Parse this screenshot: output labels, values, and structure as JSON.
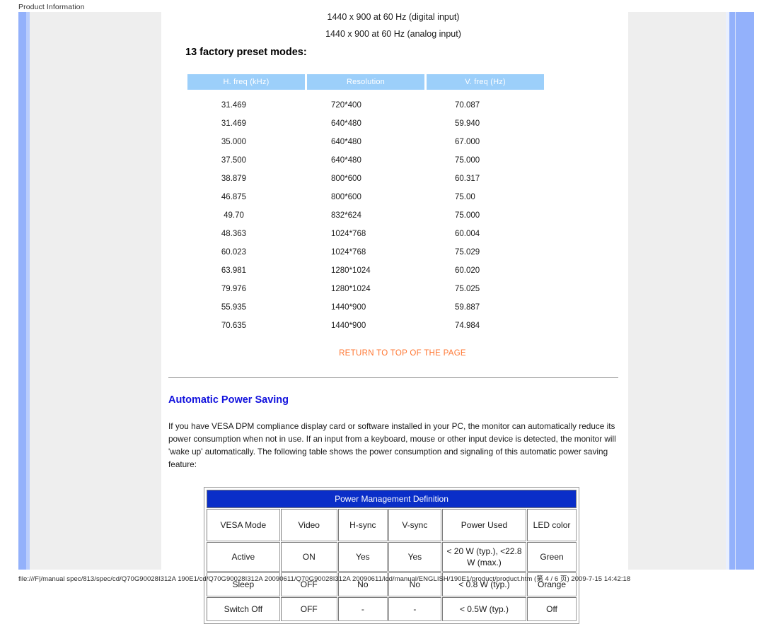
{
  "window": {
    "header_label": "Product Information",
    "footer_status": "file:///F|/manual spec/813/spec/cd/Q70G90028I312A 190E1/cd/Q70G90028I312A 20090611/Q70G90028I312A 20090611/lcd/manual/ENGLISH/190E1/product/product.htm (第 4 / 6 页) 2009-7-15 14:42:18"
  },
  "colors": {
    "rail_blue": "#93b1fb",
    "panel_grey": "#eeeeee",
    "preset_header_blue": "#9ccffa",
    "pm_header_blue": "#0a2ec8",
    "link_orange": "#FF7733",
    "heading_blue": "#1111dd"
  },
  "resolution_lines": [
    "1440 x 900 at 60 Hz (digital input)",
    "1440 x 900 at 60 Hz (analog input)"
  ],
  "preset_section": {
    "title": "13 factory preset modes:",
    "columns": [
      "H. freq (kHz)",
      "Resolution",
      "V. freq (Hz)"
    ],
    "rows": [
      [
        "31.469",
        "720*400",
        "70.087"
      ],
      [
        "31.469",
        "640*480",
        "59.940"
      ],
      [
        "35.000",
        "640*480",
        "67.000"
      ],
      [
        "37.500",
        "640*480",
        "75.000"
      ],
      [
        "38.879",
        "800*600",
        "60.317"
      ],
      [
        "46.875",
        "800*600",
        "75.00"
      ],
      [
        "49.70",
        "832*624",
        "75.000"
      ],
      [
        "48.363",
        "1024*768",
        "60.004"
      ],
      [
        "60.023",
        "1024*768",
        "75.029"
      ],
      [
        "63.981",
        "1280*1024",
        "60.020"
      ],
      [
        "79.976",
        "1280*1024",
        "75.025"
      ],
      [
        "55.935",
        "1440*900",
        "59.887"
      ],
      [
        "70.635",
        "1440*900",
        "74.984"
      ]
    ]
  },
  "return_to_top": "RETURN TO TOP OF THE PAGE",
  "power_saving": {
    "heading": "Automatic Power Saving",
    "paragraph": "If you have VESA DPM compliance display card or software installed in your PC, the monitor can automatically reduce its power consumption when not in use. If an input from a keyboard, mouse or other input device is detected, the monitor will 'wake up' automatically. The following table shows the power consumption and signaling of this automatic power saving feature:",
    "table": {
      "title": "Power Management Definition",
      "columns": [
        "VESA Mode",
        "Video",
        "H-sync",
        "V-sync",
        "Power Used",
        "LED color"
      ],
      "rows": [
        [
          "Active",
          "ON",
          "Yes",
          "Yes",
          "< 20 W (typ.), <22.8 W (max.)",
          "Green"
        ],
        [
          "Sleep",
          "OFF",
          "No",
          "No",
          "< 0.8 W (typ.)",
          "Orange"
        ],
        [
          "Switch Off",
          "OFF",
          "-",
          "-",
          "< 0.5W (typ.)",
          "Off"
        ]
      ]
    }
  }
}
